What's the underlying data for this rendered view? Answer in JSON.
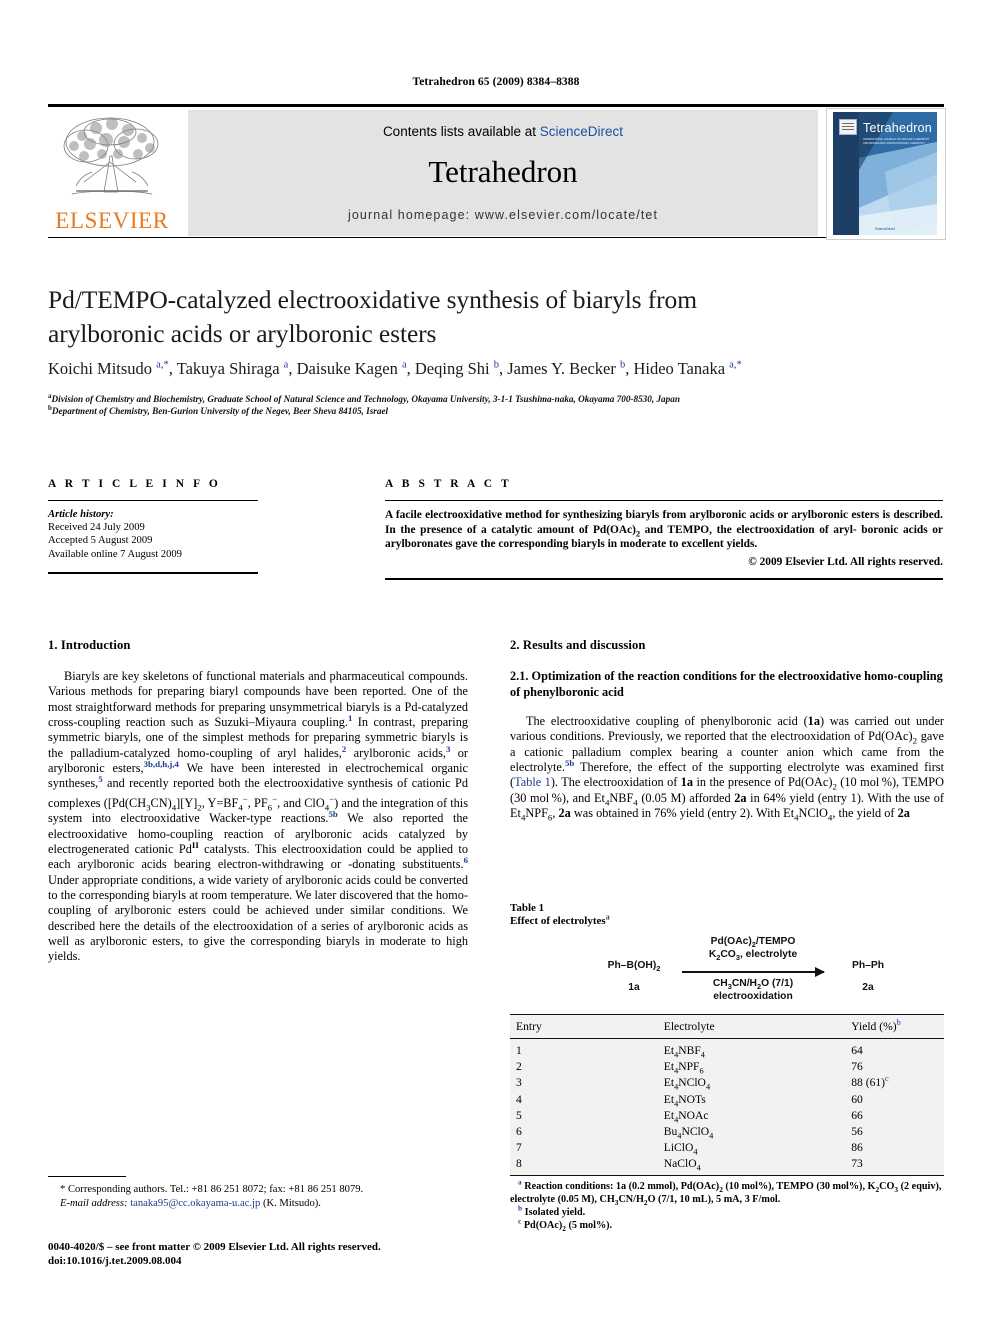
{
  "running_head": "Tetrahedron 65 (2009) 8384–8388",
  "masthead": {
    "contents_prefix": "Contents lists available at ",
    "sciencedirect": "ScienceDirect",
    "journal_name": "Tetrahedron",
    "homepage": "journal homepage: www.elsevier.com/locate/tet",
    "publisher": "ELSEVIER",
    "cover_title": "Tetrahedron",
    "cover_subtitle": "INTERNATIONAL JOURNAL OF ORGANIC CHEMISTRY AND BIOORGANIC AND BIOORGANIC CHEMISTRY",
    "cover_bottom": "ScienceDirect",
    "accent_orange": "#E87B22",
    "accent_blue": "#1a4fa0",
    "band_gray": "#e3e3e3"
  },
  "title": "Pd/TEMPO-catalyzed electrooxidative synthesis of biaryls from arylboronic acids or arylboronic esters",
  "authors_html": "Koichi Mitsudo <sup>a,*</sup>, Takuya Shiraga <sup>a</sup>, Daisuke Kagen <sup>a</sup>, Deqing Shi <sup>b</sup>, James Y. Becker <sup>b</sup>, Hideo Tanaka <sup>a,*</sup>",
  "affiliations": [
    "Division of Chemistry and Biochemistry, Graduate School of Natural Science and Technology, Okayama University, 3-1-1 Tsushima-naka, Okayama 700-8530, Japan",
    "Department of Chemistry, Ben-Gurion University of the Negev, Beer Sheva 84105, Israel"
  ],
  "info": {
    "heading": "A R T I C L E   I N F O",
    "history_label": "Article history:",
    "history": [
      "Received 24 July 2009",
      "Accepted 5 August 2009",
      "Available online 7 August 2009"
    ]
  },
  "abstract": {
    "heading": "A B S T R A C T",
    "text": "A facile electrooxidative method for synthesizing biaryls from arylboronic acids or arylboronic esters is described. In the presence of a catalytic amount of Pd(OAc)2 and TEMPO, the electrooxidation of arylboronic acids or arylboronates gave the corresponding biaryls in moderate to excellent yields.",
    "copyright": "© 2009 Elsevier Ltd. All rights reserved."
  },
  "sections": {
    "introduction_heading": "1. Introduction",
    "results_heading": "2. Results and discussion",
    "subsection_heading": "2.1. Optimization of the reaction conditions for the electrooxidative homo-coupling of phenylboronic acid"
  },
  "intro_paragraph": "Biaryls are key skeletons of functional materials and pharmaceutical compounds. Various methods for preparing biaryl compounds have been reported. One of the most straightforward methods for preparing unsymmetrical biaryls is a Pd-catalyzed cross-coupling reaction such as Suzuki–Miyaura coupling.1 In contrast, preparing symmetric biaryls, one of the simplest methods for preparing symmetric biaryls is the palladium-catalyzed homo-coupling of aryl halides,2 arylboronic acids,3 or arylboronic esters,3b,d,h,j,4 We have been interested in electrochemical organic syntheses,5 and recently reported both the electrooxidative synthesis of cationic Pd complexes ([Pd(CH3CN)4][Y]2, Y=BF4−, PF6−, and ClO4−) and the integration of this system into electrooxidative Wacker-type reactions.5b We also reported the electrooxidative homo-coupling reaction of arylboronic acids catalyzed by electrogenerated cationic PdII catalysts. This electrooxidation could be applied to each arylboronic acids bearing electron-withdrawing or -donating substituents.6 Under appropriate conditions, a wide variety of arylboronic acids could be converted to the corresponding biaryls at room temperature. We later discovered that the homo-coupling of arylboronic esters could be achieved under similar conditions. We described here the details of the electrooxidation of a series of arylboronic acids as well as arylboronic esters, to give the corresponding biaryls in moderate to high yields.",
  "results_paragraph": "The electrooxidative coupling of phenylboronic acid (1a) was carried out under various conditions. Previously, we reported that the electrooxidation of Pd(OAc)2 gave a cationic palladium complex bearing a counter anion which came from the electrolyte.5b Therefore, the effect of the supporting electrolyte was examined first (Table 1). The electrooxidation of 1a in the presence of Pd(OAc)2 (10 mol %), TEMPO (30 mol %), and Et4NBF4 (0.05 M) afforded 2a in 64% yield (entry 1). With the use of Et4NPF6, 2a was obtained in 76% yield (entry 2). With Et4NClO4, the yield of 2a",
  "table": {
    "number": "Table 1",
    "caption": "Effect of electrolytes",
    "caption_note": "a",
    "scheme": {
      "substrate": "Ph–B(OH)2",
      "substrate_label": "1a",
      "product": "Ph–Ph",
      "product_label": "2a",
      "above_line1": "Pd(OAc)2/TEMPO",
      "above_line2": "K2CO3, electrolyte",
      "below_line1": "CH3CN/H2O (7/1)",
      "below_line2": "electrooxidation"
    },
    "columns": [
      "Entry",
      "Electrolyte",
      "Yield (%)"
    ],
    "yield_note": "b",
    "rows": [
      {
        "entry": "1",
        "electrolyte": "Et4NBF4",
        "yield": "64"
      },
      {
        "entry": "2",
        "electrolyte": "Et4NPF6",
        "yield": "76"
      },
      {
        "entry": "3",
        "electrolyte": "Et4NClO4",
        "yield": "88 (61)",
        "yield_note": "c"
      },
      {
        "entry": "4",
        "electrolyte": "Et4NOTs",
        "yield": "60"
      },
      {
        "entry": "5",
        "electrolyte": "Et4NOAc",
        "yield": "66"
      },
      {
        "entry": "6",
        "electrolyte": "Bu4NClO4",
        "yield": "56"
      },
      {
        "entry": "7",
        "electrolyte": "LiClO4",
        "yield": "86"
      },
      {
        "entry": "8",
        "electrolyte": "NaClO4",
        "yield": "73"
      }
    ],
    "notes": [
      "Reaction conditions: 1a (0.2 mmol), Pd(OAc)2 (10 mol%), TEMPO (30 mol%), K2CO3 (2 equiv), electrolyte (0.05 M), CH3CN/H2O (7/1, 10 mL), 5 mA, 3 F/mol.",
      "Isolated yield.",
      "Pd(OAc)2 (5 mol%)."
    ],
    "note_markers": [
      "a",
      "b",
      "c"
    ]
  },
  "footer": {
    "corresponding": "* Corresponding authors. Tel.: +81 86 251 8072; fax: +81 86 251 8079.",
    "email_label": "E-mail address:",
    "email": "tanaka95@cc.okayama-u.ac.jp",
    "email_attrib": "(K. Mitsudo).",
    "colophon_line1": "0040-4020/$ – see front matter © 2009 Elsevier Ltd. All rights reserved.",
    "colophon_line2": "doi:10.1016/j.tet.2009.08.004"
  }
}
